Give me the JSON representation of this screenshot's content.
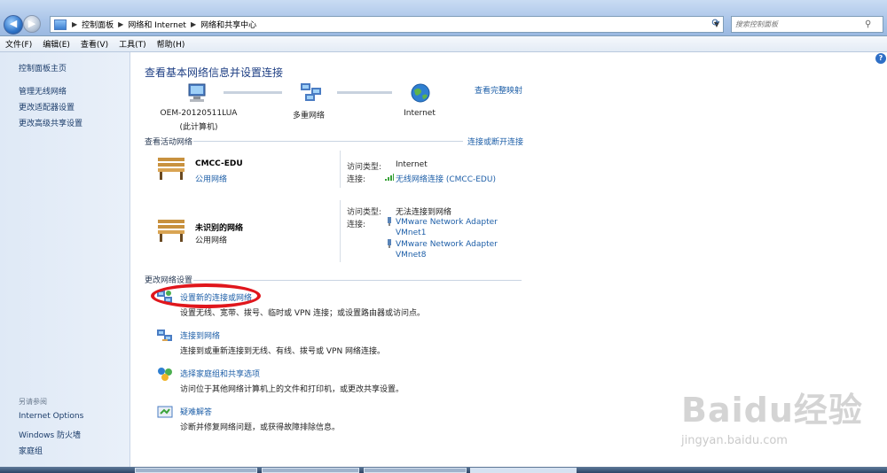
{
  "address_bar": {
    "crumbs": [
      "控制面板",
      "网络和 Internet",
      "网络和共享中心"
    ],
    "search_placeholder": "搜索控制面板"
  },
  "menu": [
    "文件(F)",
    "编辑(E)",
    "查看(V)",
    "工具(T)",
    "帮助(H)"
  ],
  "sidebar": {
    "items": [
      "控制面板主页",
      "管理无线网络",
      "更改适配器设置",
      "更改高级共享设置"
    ],
    "see_also_title": "另请参阅",
    "see_also": [
      "Internet Options",
      "Windows 防火墙",
      "家庭组"
    ]
  },
  "main": {
    "heading": "查看基本网络信息并设置连接",
    "view_full_map": "查看完整映射",
    "map_nodes": {
      "computer_name": "OEM-20120511LUA",
      "computer_sub": "(此计算机)",
      "multi_network": "多重网络",
      "internet": "Internet"
    },
    "active_networks_title": "查看活动网络",
    "connect_disconnect": "连接或断开连接",
    "networks": [
      {
        "name": "CMCC-EDU",
        "type": "公用网络",
        "access_label": "访问类型:",
        "access_value": "Internet",
        "conn_label": "连接:",
        "conn_links": [
          "无线网络连接 (CMCC-EDU)"
        ]
      },
      {
        "name": "未识别的网络",
        "type": "公用网络",
        "access_label": "访问类型:",
        "access_value": "无法连接到网络",
        "conn_label": "连接:",
        "conn_links": [
          "VMware Network Adapter",
          "VMnet1",
          "VMware Network Adapter",
          "VMnet8"
        ]
      }
    ],
    "change_settings_title": "更改网络设置",
    "tasks": [
      {
        "title": "设置新的连接或网络",
        "desc": "设置无线、宽带、拨号、临时或 VPN 连接；或设置路由器或访问点。"
      },
      {
        "title": "连接到网络",
        "desc": "连接到或重新连接到无线、有线、拨号或 VPN 网络连接。"
      },
      {
        "title": "选择家庭组和共享选项",
        "desc": "访问位于其他网络计算机上的文件和打印机，或更改共享设置。"
      },
      {
        "title": "疑难解答",
        "desc": "诊断并修复网络问题，或获得故障排除信息。"
      }
    ]
  },
  "watermark": {
    "logo": "Baidu经验",
    "sub": "jingyan.baidu.com"
  },
  "colors": {
    "link": "#1e5fa8",
    "heading": "#1e3f84",
    "annotation": "#e0161c"
  }
}
